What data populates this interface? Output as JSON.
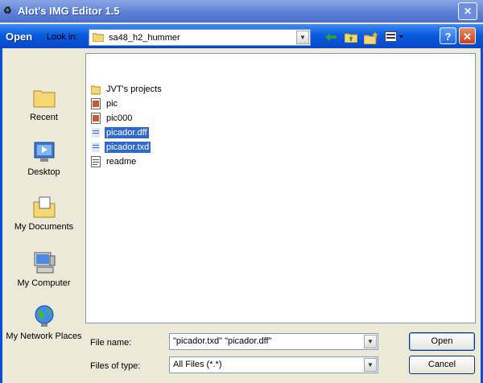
{
  "app": {
    "title": "Alot's IMG Editor 1.5",
    "close_glyph": "✕"
  },
  "dialog": {
    "title": "Open",
    "help_glyph": "?",
    "close_glyph": "✕"
  },
  "lookin": {
    "label": "Look in:",
    "value": "sa48_h2_hummer"
  },
  "places": [
    {
      "label": "Recent"
    },
    {
      "label": "Desktop"
    },
    {
      "label": "My Documents"
    },
    {
      "label": "My Computer"
    },
    {
      "label": "My Network Places"
    }
  ],
  "files": [
    {
      "name": "JVT's projects",
      "selected": false
    },
    {
      "name": "pic",
      "selected": false
    },
    {
      "name": "pic000",
      "selected": false
    },
    {
      "name": "picador.dff",
      "selected": true
    },
    {
      "name": "picador.txd",
      "selected": true
    },
    {
      "name": "readme",
      "selected": false
    }
  ],
  "filename": {
    "label": "File name:",
    "value": "\"picador.txd\" \"picador.dff\""
  },
  "filetype": {
    "label": "Files of type:",
    "value": "All Files (*.*)"
  },
  "buttons": {
    "open": "Open",
    "cancel": "Cancel"
  },
  "colors": {
    "selection": "#316ac5",
    "dialog_bg": "#ece9d8",
    "title_blue": "#0a5be0"
  }
}
